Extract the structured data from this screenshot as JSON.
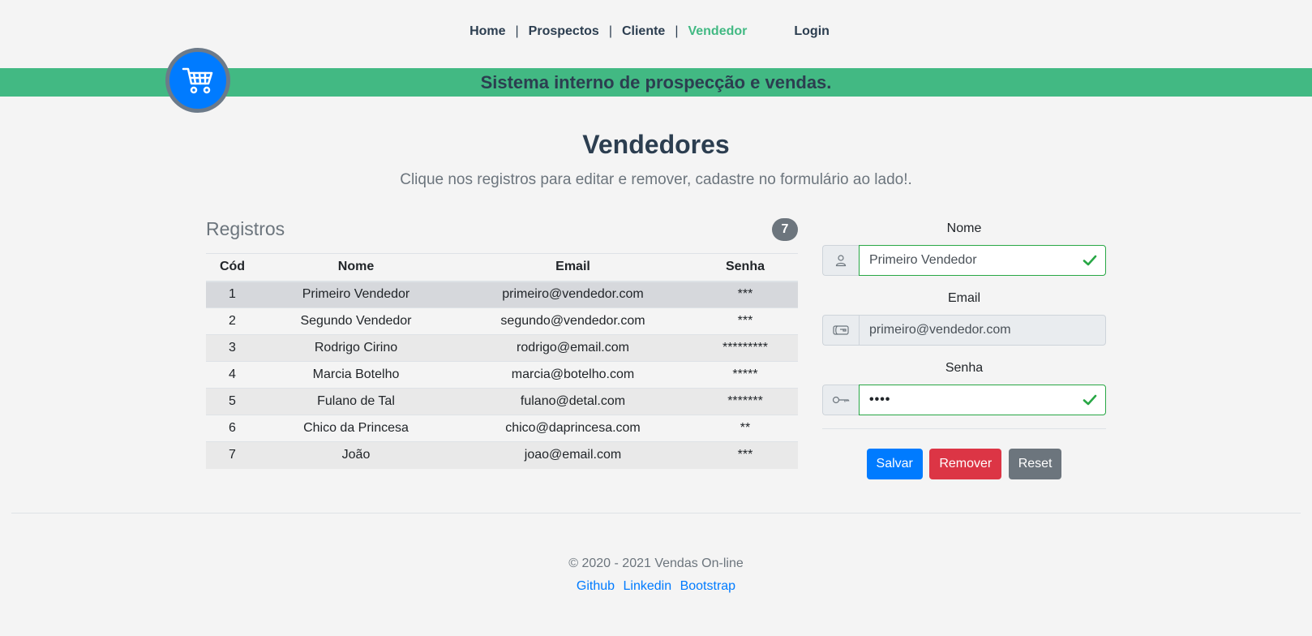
{
  "nav": {
    "home": "Home",
    "prospectos": "Prospectos",
    "cliente": "Cliente",
    "vendedor": "Vendedor",
    "separator": "|",
    "login": "Login"
  },
  "banner": {
    "title": "Sistema interno de prospecção e vendas.",
    "logo_icon": "shopping-cart-icon"
  },
  "page": {
    "title": "Vendedores",
    "subtitle": "Clique nos registros para editar e remover, cadastre no formulário ao lado!."
  },
  "records": {
    "title": "Registros",
    "count": "7",
    "columns": [
      "Cód",
      "Nome",
      "Email",
      "Senha"
    ],
    "rows": [
      [
        "1",
        "Primeiro Vendedor",
        "primeiro@vendedor.com",
        "***"
      ],
      [
        "2",
        "Segundo Vendedor",
        "segundo@vendedor.com",
        "***"
      ],
      [
        "3",
        "Rodrigo Cirino",
        "rodrigo@email.com",
        "*********"
      ],
      [
        "4",
        "Marcia Botelho",
        "marcia@botelho.com",
        "*****"
      ],
      [
        "5",
        "Fulano de Tal",
        "fulano@detal.com",
        "*******"
      ],
      [
        "6",
        "Chico da Princesa",
        "chico@daprincesa.com",
        "**"
      ],
      [
        "7",
        "João",
        "joao@email.com",
        "***"
      ]
    ],
    "selected_row": 0
  },
  "form": {
    "nome_label": "Nome",
    "nome_value": "Primeiro Vendedor",
    "email_label": "Email",
    "email_value": "primeiro@vendedor.com",
    "senha_label": "Senha",
    "senha_value": "••••",
    "save_label": "Salvar",
    "remove_label": "Remover",
    "reset_label": "Reset"
  },
  "footer": {
    "copyright": "© 2020 - 2021 Vendas On-line",
    "links": [
      "Github",
      "Linkedin",
      "Bootstrap"
    ]
  },
  "colors": {
    "accent": "#42b983",
    "primary": "#007bff",
    "danger": "#dc3545",
    "secondary": "#6c757d",
    "text": "#2c3e50"
  }
}
